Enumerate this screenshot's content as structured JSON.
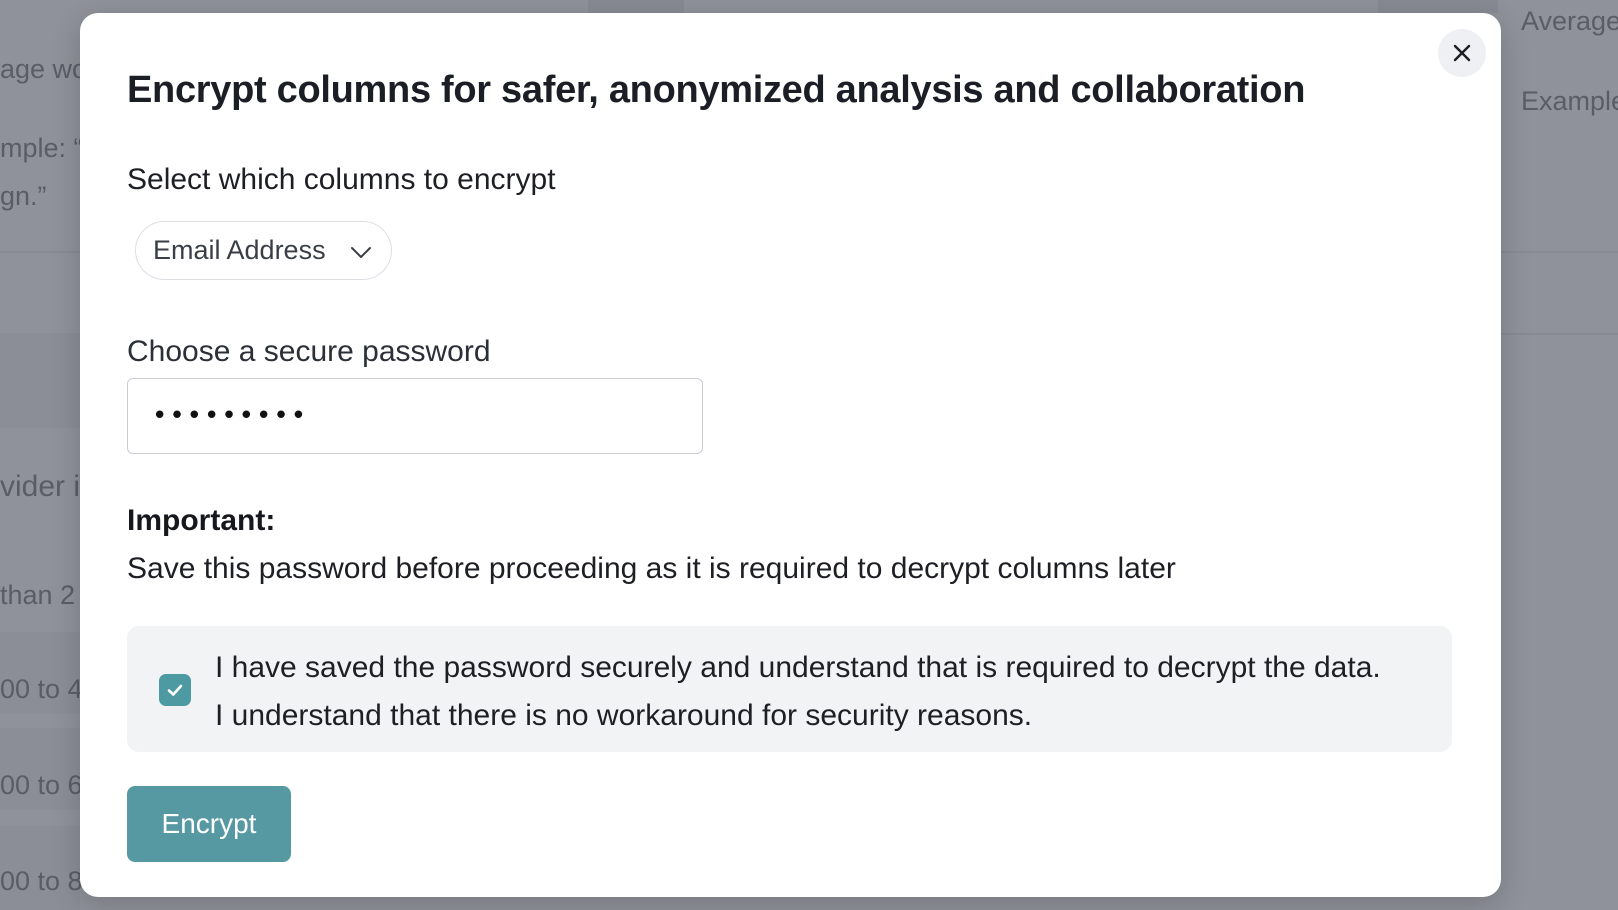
{
  "background": {
    "left_fragments": [
      "age wo",
      "mple: “I",
      "gn.”",
      "vider i",
      "than 2",
      "00 to 4",
      "00 to 6",
      "00 to 8"
    ],
    "right_fragments": [
      "Average",
      "Example"
    ]
  },
  "modal": {
    "title": "Encrypt columns for safer, anonymized analysis and collaboration",
    "select_label": "Select which columns to encrypt",
    "selected_column": "Email Address",
    "password_label": "Choose a secure password",
    "password_value": "secret123",
    "important_title": "Important:",
    "important_text": "Save this password before proceeding as it is required to decrypt columns later",
    "confirm_text": "I have saved the password securely and understand that is required to decrypt the data. I understand that there is no workaround for security reasons.",
    "confirm_checked": true,
    "encrypt_label": "Encrypt"
  },
  "icons": {
    "close": "close-icon",
    "chevron": "chevron-down-icon",
    "check": "check-icon"
  },
  "colors": {
    "accent": "#5799a2",
    "checkbox": "#4e9aa3",
    "overlay": "#8f929a"
  }
}
